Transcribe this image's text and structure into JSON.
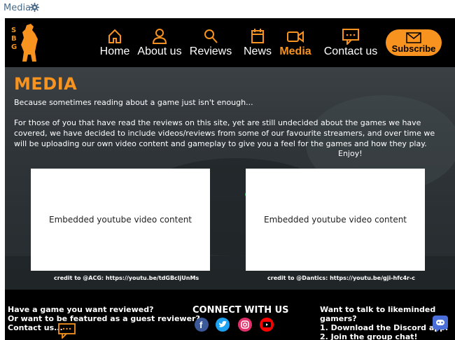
{
  "topbar": {
    "label": "Media"
  },
  "logo": {
    "letters": [
      "S",
      "B",
      "G"
    ]
  },
  "nav": [
    {
      "label": "Home",
      "icon": "home-icon"
    },
    {
      "label": "About us",
      "icon": "user-icon"
    },
    {
      "label": "Reviews",
      "icon": "search-icon"
    },
    {
      "label": "News",
      "icon": "calendar-icon"
    },
    {
      "label": "Media",
      "icon": "video-camera-icon"
    },
    {
      "label": "Contact us",
      "icon": "chat-icon"
    }
  ],
  "subscribe": {
    "label": "Subscribe",
    "icon": "envelope-icon"
  },
  "hero": {
    "title": "MEDIA",
    "intro": "Because sometimes reading about a game just isn't enough...",
    "body": "For those of you that have read the reviews on this site, yet are still undecided about the games we have covered, we have decided to include videos/reviews from some of our favourite streamers, and over time we will be uploading our own video content and gameplay to give you a feel for the games and how they play.",
    "enjoy": "Enjoy!",
    "videos": [
      {
        "text": "Embedded youtube video content",
        "credit": "credit to @ACG: https://youtu.be/tdGBcljUnMs"
      },
      {
        "text": "Embedded youtube video content",
        "credit": "credit to @Dantics: https://youtu.be/gji-hfc4r-c"
      }
    ]
  },
  "footer": {
    "left": [
      "Have a game you want reviewed?",
      "Or want to be featured as a guest reviewer?",
      "Contact us..."
    ],
    "connect": "CONNECT WITH US",
    "social": [
      {
        "name": "facebook-icon",
        "color": "#3b5998"
      },
      {
        "name": "twitter-icon",
        "color": "#1da1f2"
      },
      {
        "name": "instagram-icon",
        "color": "#e1306c"
      },
      {
        "name": "youtube-icon",
        "color": "#ff0000"
      }
    ],
    "right": [
      "Want to talk to likeminded gamers?",
      "1. Download the Discord app.",
      "2. Join the group chat!"
    ]
  },
  "colors": {
    "accent": "#f7931e",
    "background": "#000000"
  }
}
